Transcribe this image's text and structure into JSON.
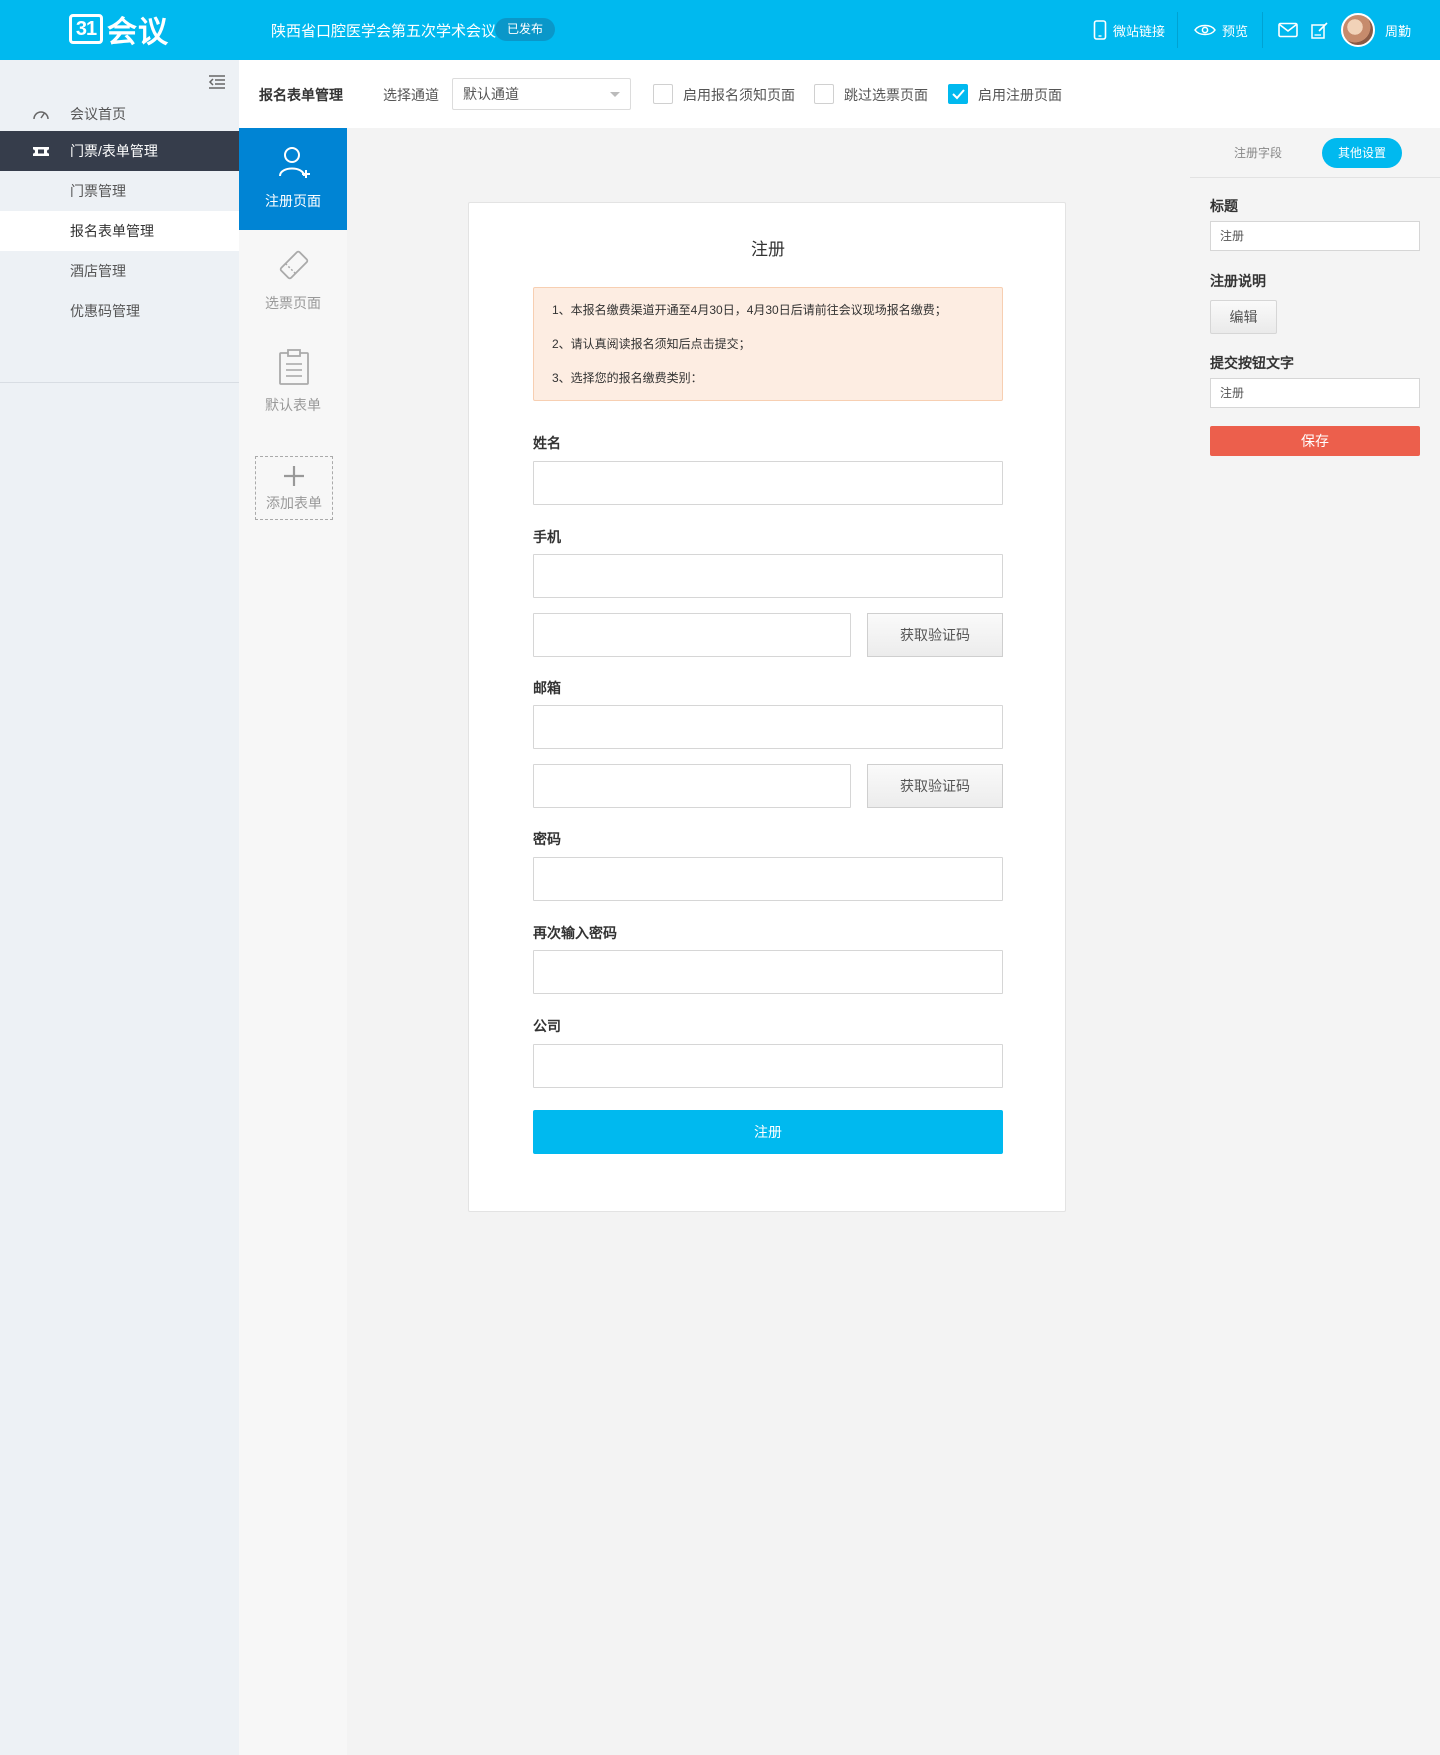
{
  "header": {
    "logo_mark": "31",
    "logo_text": "会议",
    "conference_title": "陕西省口腔医学会第五次学术会议",
    "status_badge": "已发布",
    "mobile_link_label": "微站链接",
    "preview_label": "预览",
    "user_name": "周勤"
  },
  "sidebar": {
    "items": [
      {
        "label": "会议首页",
        "icon": "dashboard-icon"
      },
      {
        "label": "门票/表单管理",
        "icon": "ticket-icon"
      },
      {
        "label": "门票管理"
      },
      {
        "label": "报名表单管理"
      },
      {
        "label": "酒店管理"
      },
      {
        "label": "优惠码管理"
      }
    ]
  },
  "toolbar": {
    "title": "报名表单管理",
    "channel_label": "选择通道",
    "channel_value": "默认通道",
    "options": [
      {
        "label": "启用报名须知页面",
        "checked": false
      },
      {
        "label": "跳过选票页面",
        "checked": false
      },
      {
        "label": "启用注册页面",
        "checked": true
      }
    ]
  },
  "form_tabs": [
    {
      "label": "注册页面",
      "icon": "user-add-icon",
      "active": true
    },
    {
      "label": "选票页面",
      "icon": "ticket-icon",
      "active": false
    },
    {
      "label": "默认表单",
      "icon": "clipboard-icon",
      "active": false
    },
    {
      "label": "添加表单",
      "icon": "plus-icon",
      "active": false
    }
  ],
  "form": {
    "title": "注册",
    "notice": [
      "1、本报名缴费渠道开通至4月30日，4月30日后请前往会议现场报名缴费；",
      "2、请认真阅读报名须知后点击提交；",
      "3、选择您的报名缴费类别："
    ],
    "fields": {
      "name": "姓名",
      "phone": "手机",
      "email": "邮箱",
      "password": "密码",
      "password_confirm": "再次输入密码",
      "company": "公司"
    },
    "get_code_label": "获取验证码",
    "submit_label": "注册"
  },
  "right_panel": {
    "tabs": [
      {
        "label": "注册字段",
        "active": false
      },
      {
        "label": "其他设置",
        "active": true
      }
    ],
    "title_label": "标题",
    "title_value": "注册",
    "description_label": "注册说明",
    "edit_label": "编辑",
    "submit_text_label": "提交按钮文字",
    "submit_text_value": "注册",
    "save_label": "保存"
  },
  "colors": {
    "brand": "#00b9ef",
    "sidebar_active": "#363d4b",
    "tab_active": "#0084d4",
    "save": "#ec5f4c",
    "notice_bg": "#fdede2"
  }
}
